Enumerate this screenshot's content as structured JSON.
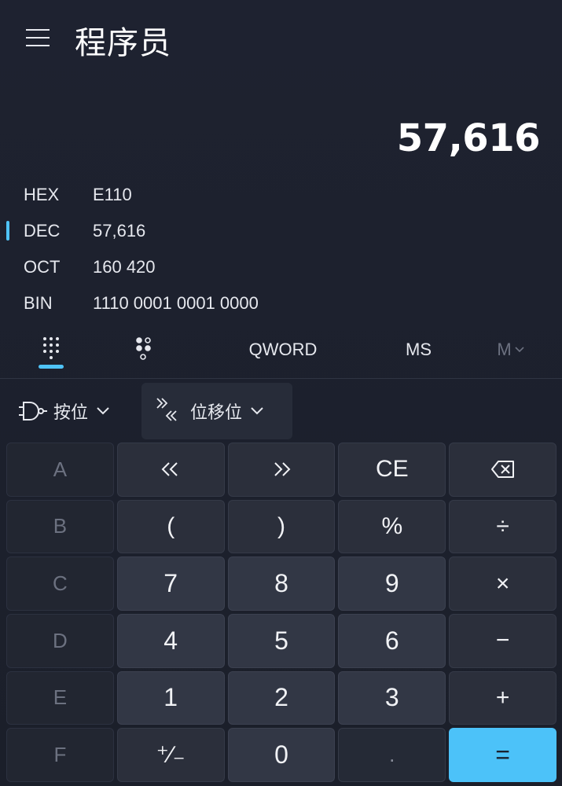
{
  "app": {
    "title": "程序员"
  },
  "display": {
    "value": "57,616"
  },
  "radix": [
    {
      "label": "HEX",
      "value": "E110",
      "active": false
    },
    {
      "label": "DEC",
      "value": "57,616",
      "active": true
    },
    {
      "label": "OCT",
      "value": "160 420",
      "active": false
    },
    {
      "label": "BIN",
      "value": "1110 0001 0001 0000",
      "active": false
    }
  ],
  "modebar": {
    "keypad_icon": "full-keypad-icon",
    "bit_toggle_icon": "bit-toggle-keypad-icon",
    "word_size": "QWORD",
    "memory_store": "MS",
    "memory_menu": "M"
  },
  "toolbar": {
    "bitwise_label": "按位",
    "bitshift_label": "位移位"
  },
  "keys": [
    {
      "id": "a",
      "label": "A",
      "type": "disabled"
    },
    {
      "id": "lshift",
      "label": "≪",
      "type": "op",
      "icon": "left-shift-icon"
    },
    {
      "id": "rshift",
      "label": "≫",
      "type": "op",
      "icon": "right-shift-icon"
    },
    {
      "id": "ce",
      "label": "CE",
      "type": "op"
    },
    {
      "id": "backspace",
      "label": "",
      "type": "op",
      "icon": "backspace-icon"
    },
    {
      "id": "b",
      "label": "B",
      "type": "disabled"
    },
    {
      "id": "lparen",
      "label": "(",
      "type": "op"
    },
    {
      "id": "rparen",
      "label": ")",
      "type": "op"
    },
    {
      "id": "percent",
      "label": "%",
      "type": "op"
    },
    {
      "id": "divide",
      "label": "÷",
      "type": "op"
    },
    {
      "id": "c",
      "label": "C",
      "type": "disabled"
    },
    {
      "id": "seven",
      "label": "7",
      "type": "num"
    },
    {
      "id": "eight",
      "label": "8",
      "type": "num"
    },
    {
      "id": "nine",
      "label": "9",
      "type": "num"
    },
    {
      "id": "multiply",
      "label": "×",
      "type": "op"
    },
    {
      "id": "d",
      "label": "D",
      "type": "disabled"
    },
    {
      "id": "four",
      "label": "4",
      "type": "num"
    },
    {
      "id": "five",
      "label": "5",
      "type": "num"
    },
    {
      "id": "six",
      "label": "6",
      "type": "num"
    },
    {
      "id": "minus",
      "label": "−",
      "type": "op"
    },
    {
      "id": "e",
      "label": "E",
      "type": "disabled"
    },
    {
      "id": "one",
      "label": "1",
      "type": "num"
    },
    {
      "id": "two",
      "label": "2",
      "type": "num"
    },
    {
      "id": "three",
      "label": "3",
      "type": "num"
    },
    {
      "id": "plus",
      "label": "+",
      "type": "op"
    },
    {
      "id": "f",
      "label": "F",
      "type": "disabled"
    },
    {
      "id": "negate",
      "label": "⁺∕₋",
      "type": "op"
    },
    {
      "id": "zero",
      "label": "0",
      "type": "num"
    },
    {
      "id": "decimal",
      "label": ".",
      "type": "dot"
    },
    {
      "id": "equals",
      "label": "=",
      "type": "equals"
    }
  ],
  "colors": {
    "accent": "#4cc2f9",
    "background": "#1c202b"
  }
}
